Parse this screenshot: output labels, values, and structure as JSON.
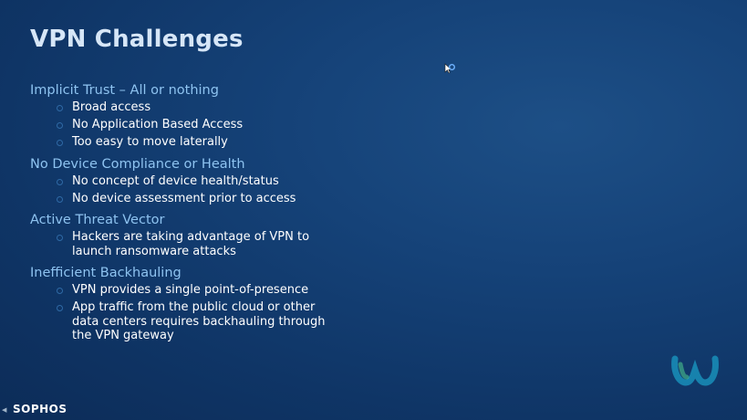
{
  "slide": {
    "title": "VPN Challenges",
    "sections": [
      {
        "heading": "Implicit Trust – All or nothing",
        "bullets": [
          "Broad access",
          "No Application Based Access",
          "Too easy to move laterally"
        ]
      },
      {
        "heading": "No Device Compliance or Health",
        "bullets": [
          "No concept of device health/status",
          "No device assessment prior to access"
        ]
      },
      {
        "heading": "Active Threat Vector",
        "bullets": [
          "Hackers are taking advantage of VPN to launch ransomware attacks"
        ]
      },
      {
        "heading": "Inefficient Backhauling",
        "bullets": [
          "VPN provides a single point-of-presence",
          "App traffic from the public cloud or other data centers requires backhauling through the VPN gateway"
        ]
      }
    ]
  },
  "branding": {
    "company_logo": "SOPHOS",
    "watermark_icon": "webex-logo-icon"
  },
  "colors": {
    "background": "#133d70",
    "title": "#d6e6f7",
    "heading": "#8ec3f0",
    "bullet_text": "#ffffff"
  }
}
